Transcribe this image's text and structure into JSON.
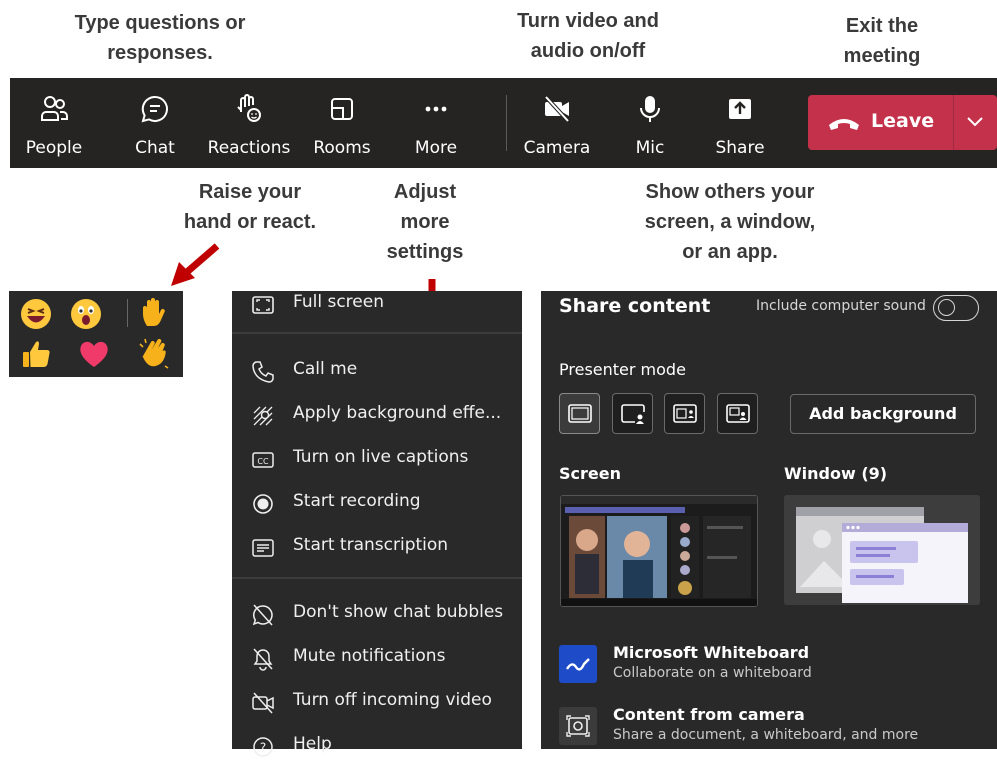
{
  "annotations": {
    "type_questions": [
      "Type questions or",
      "responses."
    ],
    "video_audio": [
      "Turn video and",
      "audio on/off"
    ],
    "exit": [
      "Exit the",
      "meeting"
    ],
    "raise_hand": [
      "Raise your",
      "hand or react."
    ],
    "adjust": [
      "Adjust",
      "more",
      "settings"
    ],
    "show_others": [
      "Show others your",
      "screen, a window,",
      "or an app."
    ]
  },
  "toolbar": {
    "people": "People",
    "chat": "Chat",
    "reactions": "Reactions",
    "rooms": "Rooms",
    "more": "More",
    "camera": "Camera",
    "mic": "Mic",
    "share": "Share",
    "leave": "Leave"
  },
  "more_menu": {
    "full_screen": "Full screen",
    "call_me": "Call me",
    "background": "Apply background effe...",
    "captions": "Turn on live captions",
    "recording": "Start recording",
    "transcription": "Start transcription",
    "chat_bubbles": "Don't show chat bubbles",
    "mute_notifications": "Mute notifications",
    "incoming_video": "Turn off incoming video",
    "help": "Help"
  },
  "share_panel": {
    "title": "Share content",
    "include_sound": "Include computer sound",
    "presenter_mode": "Presenter mode",
    "add_background": "Add background",
    "screen": "Screen",
    "window": "Window (9)",
    "whiteboard_title": "Microsoft Whiteboard",
    "whiteboard_sub": "Collaborate on a whiteboard",
    "camera_title": "Content from camera",
    "camera_sub": "Share a document, a whiteboard, and more"
  },
  "colors": {
    "toolbar_bg": "#252423",
    "leave_red": "#c4314b",
    "arrow_red": "#c00000",
    "panel_bg": "#292929"
  }
}
